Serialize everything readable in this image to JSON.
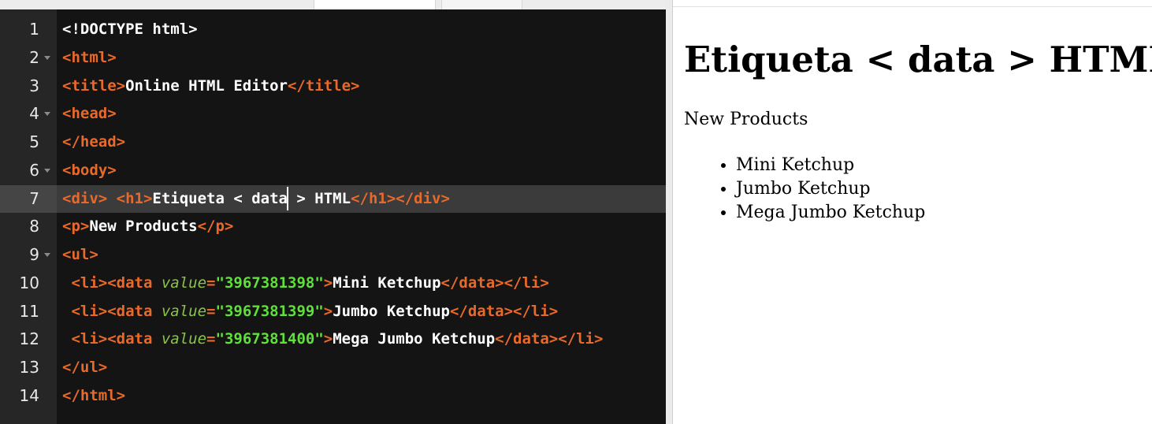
{
  "editor": {
    "lines": [
      {
        "n": "1"
      },
      {
        "n": "2"
      },
      {
        "n": "3"
      },
      {
        "n": "4"
      },
      {
        "n": "5"
      },
      {
        "n": "6"
      },
      {
        "n": "7"
      },
      {
        "n": "8"
      },
      {
        "n": "9"
      },
      {
        "n": "10"
      },
      {
        "n": "11"
      },
      {
        "n": "12"
      },
      {
        "n": "13"
      },
      {
        "n": "14"
      }
    ],
    "code": {
      "l1": "<!DOCTYPE html>",
      "l2_tag": "<html>",
      "l3_open": "<title>",
      "l3_text": "Online HTML Editor",
      "l3_close": "</title>",
      "l4": "<head>",
      "l5": "</head>",
      "l6": "<body>",
      "l7_open": "<div> <h1>",
      "l7_text_a": "Etiqueta < data",
      "l7_text_b": " > HTML",
      "l7_close": "</h1></div>",
      "l8_open": "<p>",
      "l8_text": "New Products",
      "l8_close": "</p>",
      "l9": "<ul>",
      "li_open": " <li><data ",
      "attr": "value",
      "eq": "=",
      "l10_val": "\"3967381398\"",
      "l10_text": "Mini Ketchup",
      "l11_val": "\"3967381399\"",
      "l11_text": "Jumbo Ketchup",
      "l12_val": "\"3967381400\"",
      "l12_text": "Mega Jumbo Ketchup",
      "gt": ">",
      "li_close": "</data></li>",
      "l13": "</ul>",
      "l14": "</html>"
    }
  },
  "preview": {
    "heading": "Etiqueta < data > HTML",
    "paragraph": "New Products",
    "items": [
      "Mini Ketchup",
      "Jumbo Ketchup",
      "Mega Jumbo Ketchup"
    ]
  },
  "colors": {
    "editor_bg": "#141414",
    "tag": "#e8692a",
    "attribute": "#8bc34a",
    "string": "#5fe03a",
    "text": "#ffffff"
  },
  "icons": {
    "fold": "chevron-down-icon"
  }
}
